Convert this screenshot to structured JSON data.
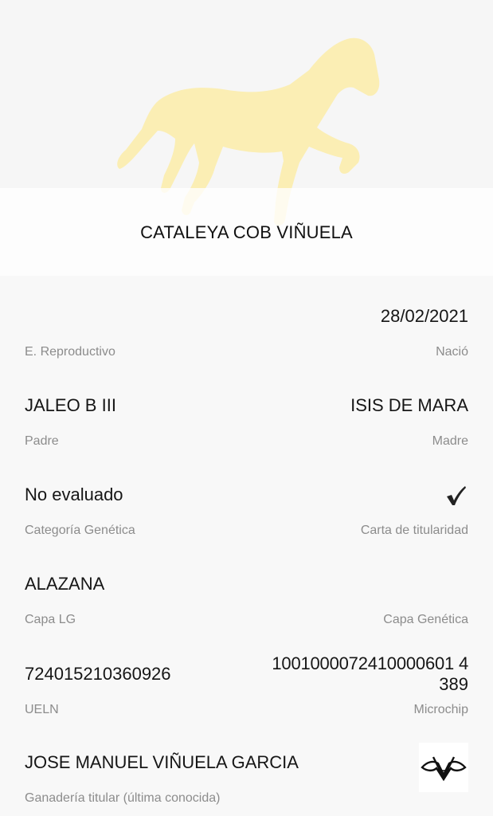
{
  "horse": {
    "name": "CATALEYA COB VIÑUELA",
    "silhouette_color": "#fbeeb4"
  },
  "fields": {
    "estado_reproductivo": {
      "label": "E. Reproductivo",
      "value": ""
    },
    "nacio": {
      "label": "Nació",
      "value": "28/02/2021"
    },
    "padre": {
      "label": "Padre",
      "value": "JALEO B III"
    },
    "madre": {
      "label": "Madre",
      "value": "ISIS DE MARA"
    },
    "categoria_genetica": {
      "label": "Categoría Genética",
      "value": "No evaluado"
    },
    "carta_titularidad": {
      "label": "Carta de titularidad",
      "icon": "checkmark-icon"
    },
    "capa_lg": {
      "label": "Capa LG",
      "value": "ALAZANA"
    },
    "capa_genetica": {
      "label": "Capa Genética",
      "value": ""
    },
    "ueln": {
      "label": "UELN",
      "value": "724015210360926"
    },
    "microchip": {
      "label": "Microchip",
      "value_line1": "1001000072410000601 4",
      "value_line2": "389"
    },
    "ganaderia": {
      "label": "Ganadería titular (última conocida)",
      "value": "JOSE MANUEL VIÑUELA GARCIA",
      "logo_icon": "ganaderia-brand-logo-icon"
    }
  }
}
